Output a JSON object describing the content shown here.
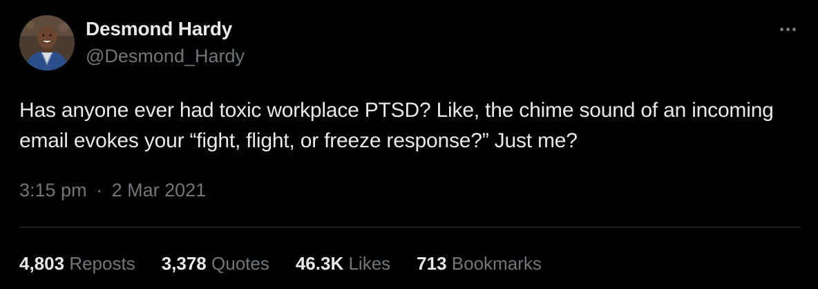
{
  "author": {
    "display_name": "Desmond Hardy",
    "handle": "@Desmond_Hardy",
    "avatar_icon": "profile-photo"
  },
  "tweet": {
    "text": "Has anyone ever had toxic workplace PTSD? Like, the chime sound of an incoming email evokes your “fight, flight, or freeze response?” Just me?",
    "time": "3:15 pm",
    "separator": "·",
    "date": "2 Mar 2021"
  },
  "stats": {
    "reposts": {
      "count": "4,803",
      "label": "Reposts"
    },
    "quotes": {
      "count": "3,378",
      "label": "Quotes"
    },
    "likes": {
      "count": "46.3K",
      "label": "Likes"
    },
    "bookmarks": {
      "count": "713",
      "label": "Bookmarks"
    }
  },
  "icons": {
    "more": "more-horizontal-icon"
  },
  "colors": {
    "background": "#000000",
    "primary_text": "#e7e9ea",
    "secondary_text": "#71767b",
    "divider": "#2f3336"
  }
}
